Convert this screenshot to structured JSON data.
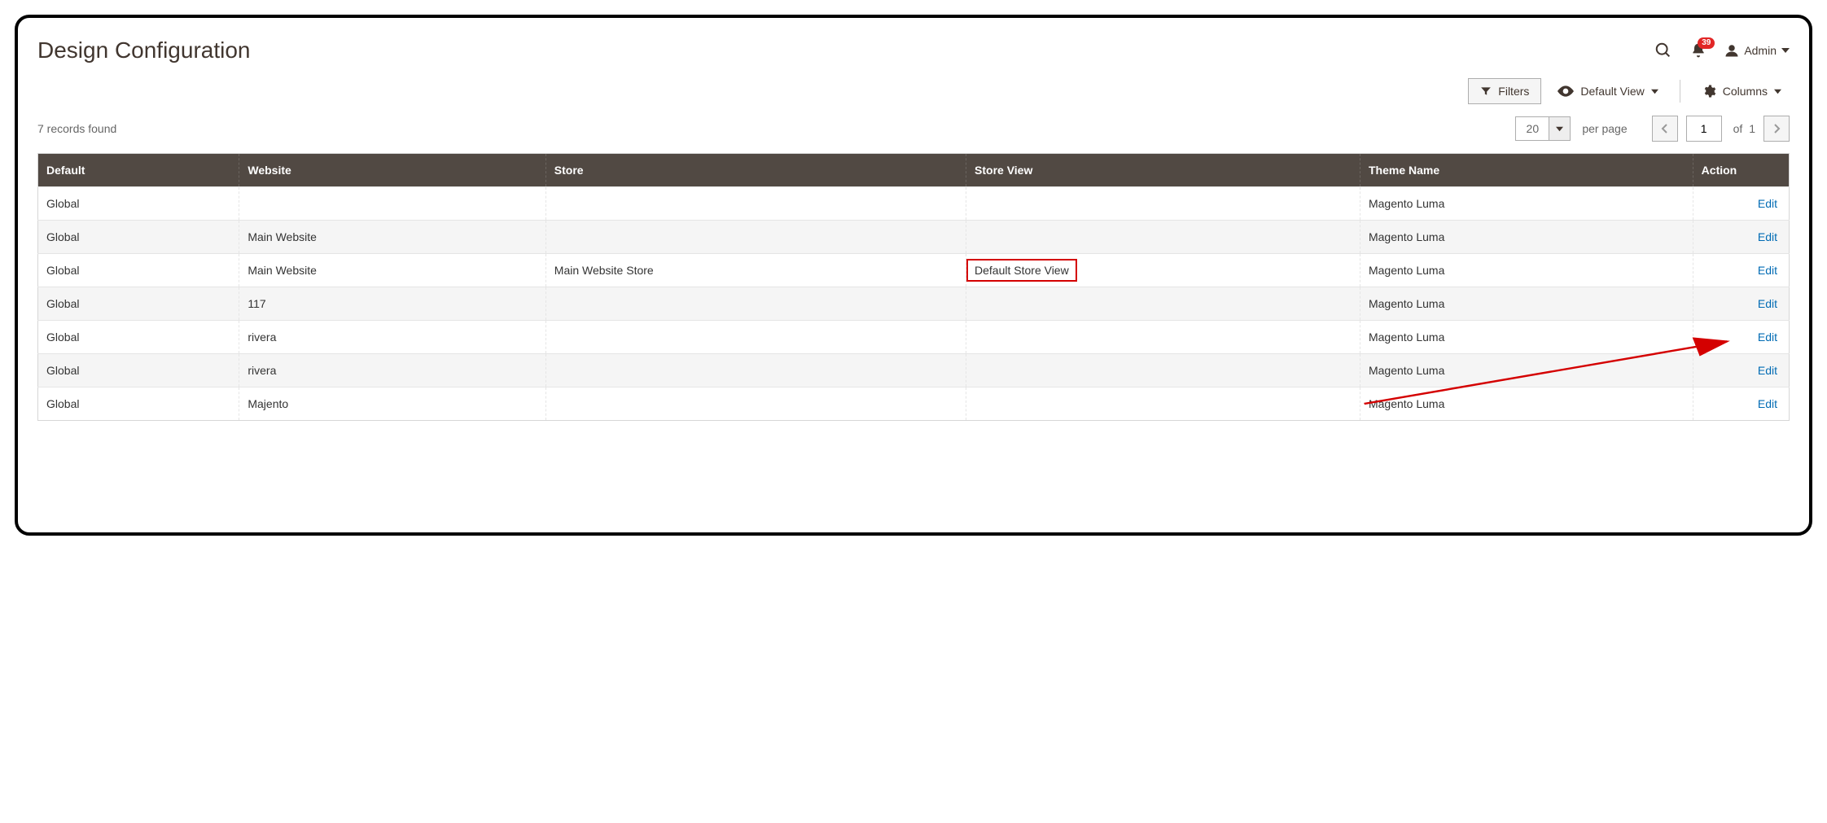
{
  "header": {
    "title": "Design Configuration",
    "notification_count": "39",
    "user_label": "Admin"
  },
  "toolbar": {
    "filters_label": "Filters",
    "default_view_label": "Default View",
    "columns_label": "Columns"
  },
  "records": {
    "found_text": "7 records found",
    "page_size": "20",
    "per_page_label": "per page",
    "current_page": "1",
    "of_label": "of",
    "total_pages": "1"
  },
  "table": {
    "columns": [
      "Default",
      "Website",
      "Store",
      "Store View",
      "Theme Name",
      "Action"
    ],
    "action_label": "Edit",
    "rows": [
      {
        "default": "Global",
        "website": "",
        "store": "",
        "store_view": "",
        "theme": "Magento Luma",
        "website_link": false,
        "highlight": false
      },
      {
        "default": "Global",
        "website": "Main Website",
        "store": "",
        "store_view": "",
        "theme": "Magento Luma",
        "website_link": false,
        "highlight": false
      },
      {
        "default": "Global",
        "website": "Main Website",
        "store": "Main Website Store",
        "store_view": "Default Store View",
        "theme": "Magento Luma",
        "website_link": false,
        "highlight": true
      },
      {
        "default": "Global",
        "website": "117",
        "store": "",
        "store_view": "",
        "theme": "Magento Luma",
        "website_link": true,
        "highlight": false
      },
      {
        "default": "Global",
        "website": "rivera",
        "store": "",
        "store_view": "",
        "theme": "Magento Luma",
        "website_link": true,
        "highlight": false
      },
      {
        "default": "Global",
        "website": "rivera",
        "store": "",
        "store_view": "",
        "theme": "Magento Luma",
        "website_link": true,
        "highlight": false
      },
      {
        "default": "Global",
        "website": "Majento",
        "store": "",
        "store_view": "",
        "theme": "Magento Luma",
        "website_link": true,
        "highlight": false
      }
    ]
  }
}
